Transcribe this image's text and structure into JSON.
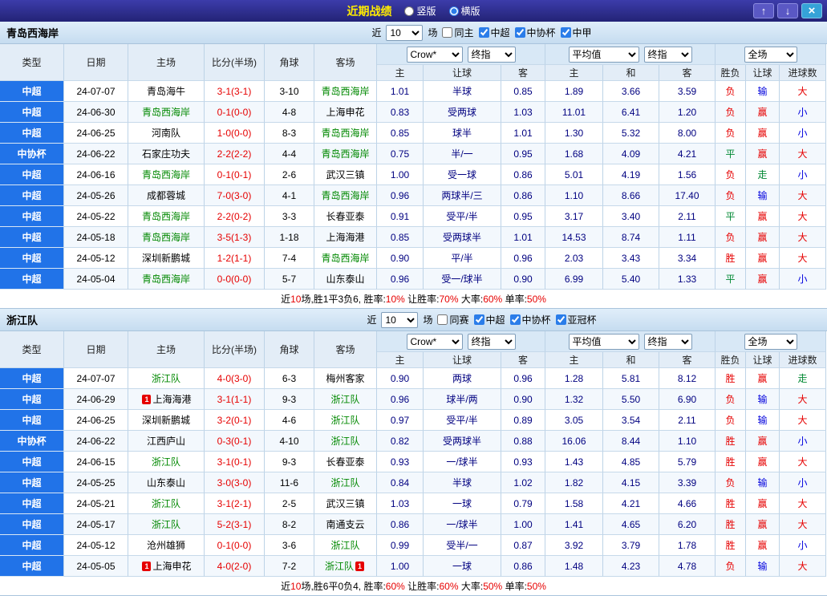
{
  "titlebar": {
    "title": "近期战绩",
    "vertical_label": "竖版",
    "horizontal_label": "横版",
    "selected_layout": "横版",
    "up_icon": "↑",
    "down_icon": "↓",
    "close_icon": "×"
  },
  "filter_template": {
    "near": "近",
    "games": "场"
  },
  "header_template": {
    "static_cols": [
      "类型",
      "日期",
      "主场",
      "比分(半场)",
      "角球",
      "客场"
    ],
    "odds_selects": [
      "Crow*",
      "终指"
    ],
    "odds_sub": [
      "主",
      "让球",
      "客"
    ],
    "avg_selects": [
      "平均值",
      "终指"
    ],
    "avg_sub": [
      "主",
      "和",
      "客"
    ],
    "full_select": "全场",
    "full_sub": [
      "胜负",
      "让球",
      "进球数"
    ]
  },
  "palette": {
    "type_blue": "#2173e8",
    "focal_green": "#008800",
    "score_red": "#e60000",
    "odds_navy": "#000080",
    "win_red": "#e60000",
    "draw_green": "#008833",
    "lose_blue": "#0000dd",
    "title_yellow": "#ffeb00"
  },
  "tables": [
    {
      "team": "青岛西海岸",
      "filter": {
        "count": "10",
        "checkboxes": [
          {
            "label": "同主",
            "checked": false
          },
          {
            "label": "中超",
            "checked": true
          },
          {
            "label": "中协杯",
            "checked": true
          },
          {
            "label": "中甲",
            "checked": true
          }
        ]
      },
      "rows": [
        {
          "type": "中超",
          "date": "24-07-07",
          "home": "青岛海牛",
          "home_focal": false,
          "score": "3-1(3-1)",
          "corner": "3-10",
          "away": "青岛西海岸",
          "away_focal": true,
          "odds": [
            "1.01",
            "半球",
            "0.85"
          ],
          "avg": [
            "1.89",
            "3.66",
            "3.59"
          ],
          "result": {
            "t": "负",
            "c": "red"
          },
          "handicap": {
            "t": "输",
            "c": "blue"
          },
          "goals": {
            "t": "大",
            "c": "red"
          }
        },
        {
          "type": "中超",
          "date": "24-06-30",
          "home": "青岛西海岸",
          "home_focal": true,
          "score": "0-1(0-0)",
          "corner": "4-8",
          "away": "上海申花",
          "away_focal": false,
          "odds": [
            "0.83",
            "受两球",
            "1.03"
          ],
          "avg": [
            "11.01",
            "6.41",
            "1.20"
          ],
          "result": {
            "t": "负",
            "c": "red"
          },
          "handicap": {
            "t": "赢",
            "c": "red"
          },
          "goals": {
            "t": "小",
            "c": "blue"
          }
        },
        {
          "type": "中超",
          "date": "24-06-25",
          "home": "河南队",
          "home_focal": false,
          "score": "1-0(0-0)",
          "corner": "8-3",
          "away": "青岛西海岸",
          "away_focal": true,
          "odds": [
            "0.85",
            "球半",
            "1.01"
          ],
          "avg": [
            "1.30",
            "5.32",
            "8.00"
          ],
          "result": {
            "t": "负",
            "c": "red"
          },
          "handicap": {
            "t": "赢",
            "c": "red"
          },
          "goals": {
            "t": "小",
            "c": "blue"
          }
        },
        {
          "type": "中协杯",
          "date": "24-06-22",
          "home": "石家庄功夫",
          "home_focal": false,
          "score": "2-2(2-2)",
          "corner": "4-4",
          "away": "青岛西海岸",
          "away_focal": true,
          "odds": [
            "0.75",
            "半/一",
            "0.95"
          ],
          "avg": [
            "1.68",
            "4.09",
            "4.21"
          ],
          "result": {
            "t": "平",
            "c": "green"
          },
          "handicap": {
            "t": "赢",
            "c": "red"
          },
          "goals": {
            "t": "大",
            "c": "red"
          }
        },
        {
          "type": "中超",
          "date": "24-06-16",
          "home": "青岛西海岸",
          "home_focal": true,
          "score": "0-1(0-1)",
          "corner": "2-6",
          "away": "武汉三镇",
          "away_focal": false,
          "odds": [
            "1.00",
            "受一球",
            "0.86"
          ],
          "avg": [
            "5.01",
            "4.19",
            "1.56"
          ],
          "result": {
            "t": "负",
            "c": "red"
          },
          "handicap": {
            "t": "走",
            "c": "green"
          },
          "goals": {
            "t": "小",
            "c": "blue"
          }
        },
        {
          "type": "中超",
          "date": "24-05-26",
          "home": "成都蓉城",
          "home_focal": false,
          "score": "7-0(3-0)",
          "corner": "4-1",
          "away": "青岛西海岸",
          "away_focal": true,
          "odds": [
            "0.96",
            "两球半/三",
            "0.86"
          ],
          "avg": [
            "1.10",
            "8.66",
            "17.40"
          ],
          "result": {
            "t": "负",
            "c": "red"
          },
          "handicap": {
            "t": "输",
            "c": "blue"
          },
          "goals": {
            "t": "大",
            "c": "red"
          }
        },
        {
          "type": "中超",
          "date": "24-05-22",
          "home": "青岛西海岸",
          "home_focal": true,
          "score": "2-2(0-2)",
          "corner": "3-3",
          "away": "长春亚泰",
          "away_focal": false,
          "odds": [
            "0.91",
            "受平/半",
            "0.95"
          ],
          "avg": [
            "3.17",
            "3.40",
            "2.11"
          ],
          "result": {
            "t": "平",
            "c": "green"
          },
          "handicap": {
            "t": "赢",
            "c": "red"
          },
          "goals": {
            "t": "大",
            "c": "red"
          }
        },
        {
          "type": "中超",
          "date": "24-05-18",
          "home": "青岛西海岸",
          "home_focal": true,
          "score": "3-5(1-3)",
          "corner": "1-18",
          "away": "上海海港",
          "away_focal": false,
          "odds": [
            "0.85",
            "受两球半",
            "1.01"
          ],
          "avg": [
            "14.53",
            "8.74",
            "1.11"
          ],
          "result": {
            "t": "负",
            "c": "red"
          },
          "handicap": {
            "t": "赢",
            "c": "red"
          },
          "goals": {
            "t": "大",
            "c": "red"
          }
        },
        {
          "type": "中超",
          "date": "24-05-12",
          "home": "深圳新鹏城",
          "home_focal": false,
          "score": "1-2(1-1)",
          "corner": "7-4",
          "away": "青岛西海岸",
          "away_focal": true,
          "odds": [
            "0.90",
            "平/半",
            "0.96"
          ],
          "avg": [
            "2.03",
            "3.43",
            "3.34"
          ],
          "result": {
            "t": "胜",
            "c": "red"
          },
          "handicap": {
            "t": "赢",
            "c": "red"
          },
          "goals": {
            "t": "大",
            "c": "red"
          }
        },
        {
          "type": "中超",
          "date": "24-05-04",
          "home": "青岛西海岸",
          "home_focal": true,
          "score": "0-0(0-0)",
          "corner": "5-7",
          "away": "山东泰山",
          "away_focal": false,
          "odds": [
            "0.96",
            "受一/球半",
            "0.90"
          ],
          "avg": [
            "6.99",
            "5.40",
            "1.33"
          ],
          "result": {
            "t": "平",
            "c": "green"
          },
          "handicap": {
            "t": "赢",
            "c": "red"
          },
          "goals": {
            "t": "小",
            "c": "blue"
          }
        }
      ],
      "summary": [
        {
          "t": "近"
        },
        {
          "t": "10",
          "red": true
        },
        {
          "t": "场,胜1平3负6, 胜率:"
        },
        {
          "t": "10%",
          "red": true
        },
        {
          "t": " 让胜率:"
        },
        {
          "t": "70%",
          "red": true
        },
        {
          "t": " 大率:"
        },
        {
          "t": "60%",
          "red": true
        },
        {
          "t": " 单率:"
        },
        {
          "t": "50%",
          "red": true
        }
      ]
    },
    {
      "team": "浙江队",
      "filter": {
        "count": "10",
        "checkboxes": [
          {
            "label": "同赛",
            "checked": false
          },
          {
            "label": "中超",
            "checked": true
          },
          {
            "label": "中协杯",
            "checked": true
          },
          {
            "label": "亚冠杯",
            "checked": true
          }
        ]
      },
      "rows": [
        {
          "type": "中超",
          "date": "24-07-07",
          "home": "浙江队",
          "home_focal": true,
          "score": "4-0(3-0)",
          "corner": "6-3",
          "away": "梅州客家",
          "away_focal": false,
          "odds": [
            "0.90",
            "两球",
            "0.96"
          ],
          "avg": [
            "1.28",
            "5.81",
            "8.12"
          ],
          "result": {
            "t": "胜",
            "c": "red"
          },
          "handicap": {
            "t": "赢",
            "c": "red"
          },
          "goals": {
            "t": "走",
            "c": "green"
          }
        },
        {
          "type": "中超",
          "date": "24-06-29",
          "home": "上海海港",
          "home_focal": false,
          "home_badge": "1",
          "home_badge_pos": "before",
          "score": "3-1(1-1)",
          "corner": "9-3",
          "away": "浙江队",
          "away_focal": true,
          "odds": [
            "0.96",
            "球半/两",
            "0.90"
          ],
          "avg": [
            "1.32",
            "5.50",
            "6.90"
          ],
          "result": {
            "t": "负",
            "c": "red"
          },
          "handicap": {
            "t": "输",
            "c": "blue"
          },
          "goals": {
            "t": "大",
            "c": "red"
          }
        },
        {
          "type": "中超",
          "date": "24-06-25",
          "home": "深圳新鹏城",
          "home_focal": false,
          "score": "3-2(0-1)",
          "corner": "4-6",
          "away": "浙江队",
          "away_focal": true,
          "odds": [
            "0.97",
            "受平/半",
            "0.89"
          ],
          "avg": [
            "3.05",
            "3.54",
            "2.11"
          ],
          "result": {
            "t": "负",
            "c": "red"
          },
          "handicap": {
            "t": "输",
            "c": "blue"
          },
          "goals": {
            "t": "大",
            "c": "red"
          }
        },
        {
          "type": "中协杯",
          "date": "24-06-22",
          "home": "江西庐山",
          "home_focal": false,
          "score": "0-3(0-1)",
          "corner": "4-10",
          "away": "浙江队",
          "away_focal": true,
          "odds": [
            "0.82",
            "受两球半",
            "0.88"
          ],
          "avg": [
            "16.06",
            "8.44",
            "1.10"
          ],
          "result": {
            "t": "胜",
            "c": "red"
          },
          "handicap": {
            "t": "赢",
            "c": "red"
          },
          "goals": {
            "t": "小",
            "c": "blue"
          }
        },
        {
          "type": "中超",
          "date": "24-06-15",
          "home": "浙江队",
          "home_focal": true,
          "score": "3-1(0-1)",
          "corner": "9-3",
          "away": "长春亚泰",
          "away_focal": false,
          "odds": [
            "0.93",
            "一/球半",
            "0.93"
          ],
          "avg": [
            "1.43",
            "4.85",
            "5.79"
          ],
          "result": {
            "t": "胜",
            "c": "red"
          },
          "handicap": {
            "t": "赢",
            "c": "red"
          },
          "goals": {
            "t": "大",
            "c": "red"
          }
        },
        {
          "type": "中超",
          "date": "24-05-25",
          "home": "山东泰山",
          "home_focal": false,
          "score": "3-0(3-0)",
          "corner": "11-6",
          "away": "浙江队",
          "away_focal": true,
          "odds": [
            "0.84",
            "半球",
            "1.02"
          ],
          "avg": [
            "1.82",
            "4.15",
            "3.39"
          ],
          "result": {
            "t": "负",
            "c": "red"
          },
          "handicap": {
            "t": "输",
            "c": "blue"
          },
          "goals": {
            "t": "小",
            "c": "blue"
          }
        },
        {
          "type": "中超",
          "date": "24-05-21",
          "home": "浙江队",
          "home_focal": true,
          "score": "3-1(2-1)",
          "corner": "2-5",
          "away": "武汉三镇",
          "away_focal": false,
          "odds": [
            "1.03",
            "一球",
            "0.79"
          ],
          "avg": [
            "1.58",
            "4.21",
            "4.66"
          ],
          "result": {
            "t": "胜",
            "c": "red"
          },
          "handicap": {
            "t": "赢",
            "c": "red"
          },
          "goals": {
            "t": "大",
            "c": "red"
          }
        },
        {
          "type": "中超",
          "date": "24-05-17",
          "home": "浙江队",
          "home_focal": true,
          "score": "5-2(3-1)",
          "corner": "8-2",
          "away": "南通支云",
          "away_focal": false,
          "odds": [
            "0.86",
            "一/球半",
            "1.00"
          ],
          "avg": [
            "1.41",
            "4.65",
            "6.20"
          ],
          "result": {
            "t": "胜",
            "c": "red"
          },
          "handicap": {
            "t": "赢",
            "c": "red"
          },
          "goals": {
            "t": "大",
            "c": "red"
          }
        },
        {
          "type": "中超",
          "date": "24-05-12",
          "home": "沧州雄狮",
          "home_focal": false,
          "score": "0-1(0-0)",
          "corner": "3-6",
          "away": "浙江队",
          "away_focal": true,
          "odds": [
            "0.99",
            "受半/一",
            "0.87"
          ],
          "avg": [
            "3.92",
            "3.79",
            "1.78"
          ],
          "result": {
            "t": "胜",
            "c": "red"
          },
          "handicap": {
            "t": "赢",
            "c": "red"
          },
          "goals": {
            "t": "小",
            "c": "blue"
          }
        },
        {
          "type": "中超",
          "date": "24-05-05",
          "home": "上海申花",
          "home_focal": false,
          "home_badge": "1",
          "home_badge_pos": "before",
          "score": "4-0(2-0)",
          "corner": "7-2",
          "away": "浙江队",
          "away_focal": true,
          "away_badge": "1",
          "away_badge_pos": "after",
          "odds": [
            "1.00",
            "一球",
            "0.86"
          ],
          "avg": [
            "1.48",
            "4.23",
            "4.78"
          ],
          "result": {
            "t": "负",
            "c": "red"
          },
          "handicap": {
            "t": "输",
            "c": "blue"
          },
          "goals": {
            "t": "大",
            "c": "red"
          }
        }
      ],
      "summary": [
        {
          "t": "近"
        },
        {
          "t": "10",
          "red": true
        },
        {
          "t": "场,胜6平0负4, 胜率:"
        },
        {
          "t": "60%",
          "red": true
        },
        {
          "t": " 让胜率:"
        },
        {
          "t": "60%",
          "red": true
        },
        {
          "t": " 大率:"
        },
        {
          "t": "50%",
          "red": true
        },
        {
          "t": " 单率:"
        },
        {
          "t": "50%",
          "red": true
        }
      ]
    }
  ]
}
